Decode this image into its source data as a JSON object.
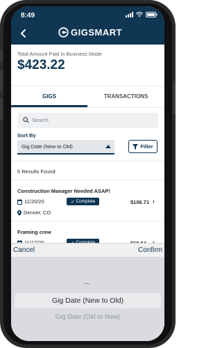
{
  "status": {
    "time": "8:49"
  },
  "header": {
    "brand": "GIGSMART"
  },
  "summary": {
    "label": "Total Amount Paid in Business Mode",
    "amount": "$423.22"
  },
  "tabs": [
    {
      "label": "GIGS",
      "active": true
    },
    {
      "label": "TRANSACTIONS",
      "active": false
    }
  ],
  "search": {
    "placeholder": "Search"
  },
  "sort": {
    "label": "Sort By",
    "value": "Gig Date (New to Old)",
    "filter_label": "Filter"
  },
  "results": {
    "count_text": "5 Results Found"
  },
  "gigs": [
    {
      "title": "Construction Manager Needed ASAP!",
      "date": "11/20/20",
      "status": "Complete",
      "price": "$106.71",
      "location": "Denver, CO"
    },
    {
      "title": "Framing crew",
      "date": "11/17/20",
      "status": "Complete",
      "price": "$68.54"
    }
  ],
  "picker": {
    "cancel": "Cancel",
    "confirm": "Confirm",
    "options": [
      "Gig Date (New to Old)",
      "Gig Date (Old to New)"
    ],
    "selected": "Gig Date (New to Old)"
  },
  "colors": {
    "primary": "#0f3653",
    "background": "#ffffff",
    "picker_bg": "#d9dbde"
  }
}
